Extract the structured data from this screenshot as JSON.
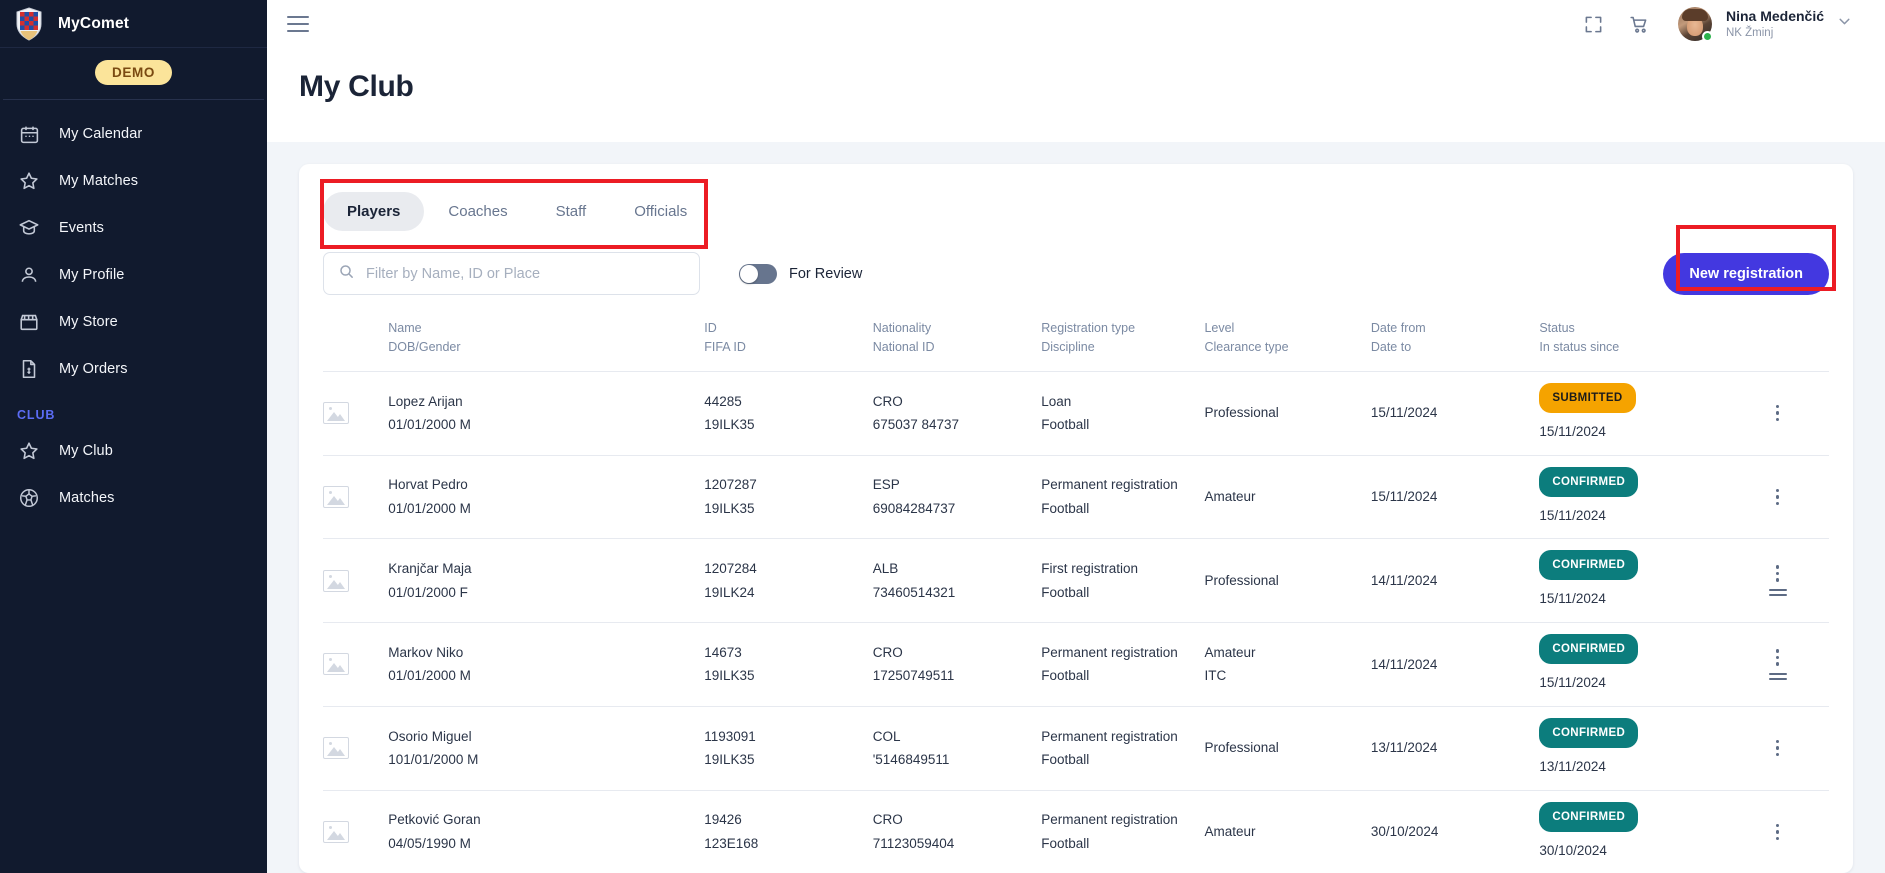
{
  "sidebar": {
    "brand": "MyComet",
    "brand_logo_icon": "croatian-checkerboard-shield-icon",
    "demo_badge": "DEMO",
    "items": [
      {
        "label": "My Calendar",
        "icon": "calendar-icon"
      },
      {
        "label": "My Matches",
        "icon": "star-icon"
      },
      {
        "label": "Events",
        "icon": "graduation-cap-icon"
      },
      {
        "label": "My Profile",
        "icon": "person-icon"
      },
      {
        "label": "My Store",
        "icon": "store-icon"
      },
      {
        "label": "My Orders",
        "icon": "document-dollar-icon"
      }
    ],
    "section_label": "CLUB",
    "club_items": [
      {
        "label": "My Club",
        "icon": "star-icon"
      },
      {
        "label": "Matches",
        "icon": "football-icon"
      }
    ]
  },
  "topbar": {
    "menu_icon": "hamburger-icon",
    "expand_icon": "fullscreen-expand-icon",
    "cart_icon": "shopping-cart-icon",
    "avatar_icon": "user-avatar",
    "user_name": "Nina Medenčić",
    "user_club": "NK Žminj",
    "chevron_icon": "chevron-down-icon"
  },
  "page": {
    "title": "My Club"
  },
  "tabs": [
    {
      "label": "Players",
      "active": true
    },
    {
      "label": "Coaches",
      "active": false
    },
    {
      "label": "Staff",
      "active": false
    },
    {
      "label": "Officials",
      "active": false
    }
  ],
  "filters": {
    "search_placeholder": "Filter by Name, ID or Place",
    "search_value": "",
    "search_icon": "search-icon",
    "toggle_label": "For Review",
    "toggle_on": false,
    "new_registration_label": "New registration"
  },
  "table": {
    "headers": [
      {
        "main": "",
        "sub": ""
      },
      {
        "main": "Name",
        "sub": "DOB/Gender"
      },
      {
        "main": "ID",
        "sub": "FIFA ID"
      },
      {
        "main": "Nationality",
        "sub": "National ID"
      },
      {
        "main": "Registration type",
        "sub": "Discipline"
      },
      {
        "main": "Level",
        "sub": "Clearance type"
      },
      {
        "main": "Date from",
        "sub": "Date to"
      },
      {
        "main": "Status",
        "sub": "In status since"
      },
      {
        "main": "",
        "sub": ""
      }
    ],
    "rows": [
      {
        "name": "Lopez  Arijan",
        "dob_gender": "01/01/2000 M",
        "id": "44285",
        "fifa_id": "19ILK35",
        "nationality": "CRO",
        "national_id": "675037 84737",
        "registration_type": "Loan",
        "discipline": "Football",
        "level": "Professional",
        "clearance_type": "",
        "date_from": "15/11/2024",
        "date_to": "",
        "status": "SUBMITTED",
        "status_kind": "submitted",
        "in_status_since": "15/11/2024",
        "has_lines": false
      },
      {
        "name": "Horvat Pedro",
        "dob_gender": "01/01/2000 M",
        "id": "1207287",
        "fifa_id": "19ILK35",
        "nationality": "ESP",
        "national_id": "69084284737",
        "registration_type": "Permanent registration",
        "discipline": "Football",
        "level": "Amateur",
        "clearance_type": "",
        "date_from": "15/11/2024",
        "date_to": "",
        "status": "CONFIRMED",
        "status_kind": "confirmed",
        "in_status_since": "15/11/2024",
        "has_lines": false
      },
      {
        "name": "Kranjčar  Maja",
        "dob_gender": "01/01/2000 F",
        "id": "1207284",
        "fifa_id": "19ILK24",
        "nationality": "ALB",
        "national_id": "73460514321",
        "registration_type": "First registration",
        "discipline": "Football",
        "level": "Professional",
        "clearance_type": "",
        "date_from": "14/11/2024",
        "date_to": "",
        "status": "CONFIRMED",
        "status_kind": "confirmed",
        "in_status_since": "15/11/2024",
        "has_lines": true
      },
      {
        "name": "Markov  Niko",
        "dob_gender": "01/01/2000 M",
        "id": "14673",
        "fifa_id": "19ILK35",
        "nationality": "CRO",
        "national_id": "17250749511",
        "registration_type": "Permanent registration",
        "discipline": "Football",
        "level": "Amateur",
        "clearance_type": "ITC",
        "date_from": "14/11/2024",
        "date_to": "",
        "status": "CONFIRMED",
        "status_kind": "confirmed",
        "in_status_since": "15/11/2024",
        "has_lines": true
      },
      {
        "name": "Osorio Miguel",
        "dob_gender": "101/01/2000 M",
        "id": "1193091",
        "fifa_id": "19ILK35",
        "nationality": "COL",
        "national_id": "'5146849511",
        "registration_type": "Permanent registration",
        "discipline": "Football",
        "level": "Professional",
        "clearance_type": "",
        "date_from": "13/11/2024",
        "date_to": "",
        "status": "CONFIRMED",
        "status_kind": "confirmed",
        "in_status_since": "13/11/2024",
        "has_lines": false
      },
      {
        "name": "Petković Goran",
        "dob_gender": "04/05/1990 M",
        "id": "19426",
        "fifa_id": "123E168",
        "nationality": "CRO",
        "national_id": "71123059404",
        "registration_type": "Permanent registration",
        "discipline": "Football",
        "level": "Amateur",
        "clearance_type": "",
        "date_from": "30/10/2024",
        "date_to": "",
        "status": "CONFIRMED",
        "status_kind": "confirmed",
        "in_status_since": "30/10/2024",
        "has_lines": false
      }
    ]
  },
  "colors": {
    "sidebar_bg": "#111a2e",
    "accent": "#4338e0",
    "section_label": "#5b6cf5",
    "status_submitted": "#f5a300",
    "status_confirmed": "#0c7d7d",
    "annotation": "#ec1c24",
    "demo_badge_bg": "#fbe49a"
  }
}
